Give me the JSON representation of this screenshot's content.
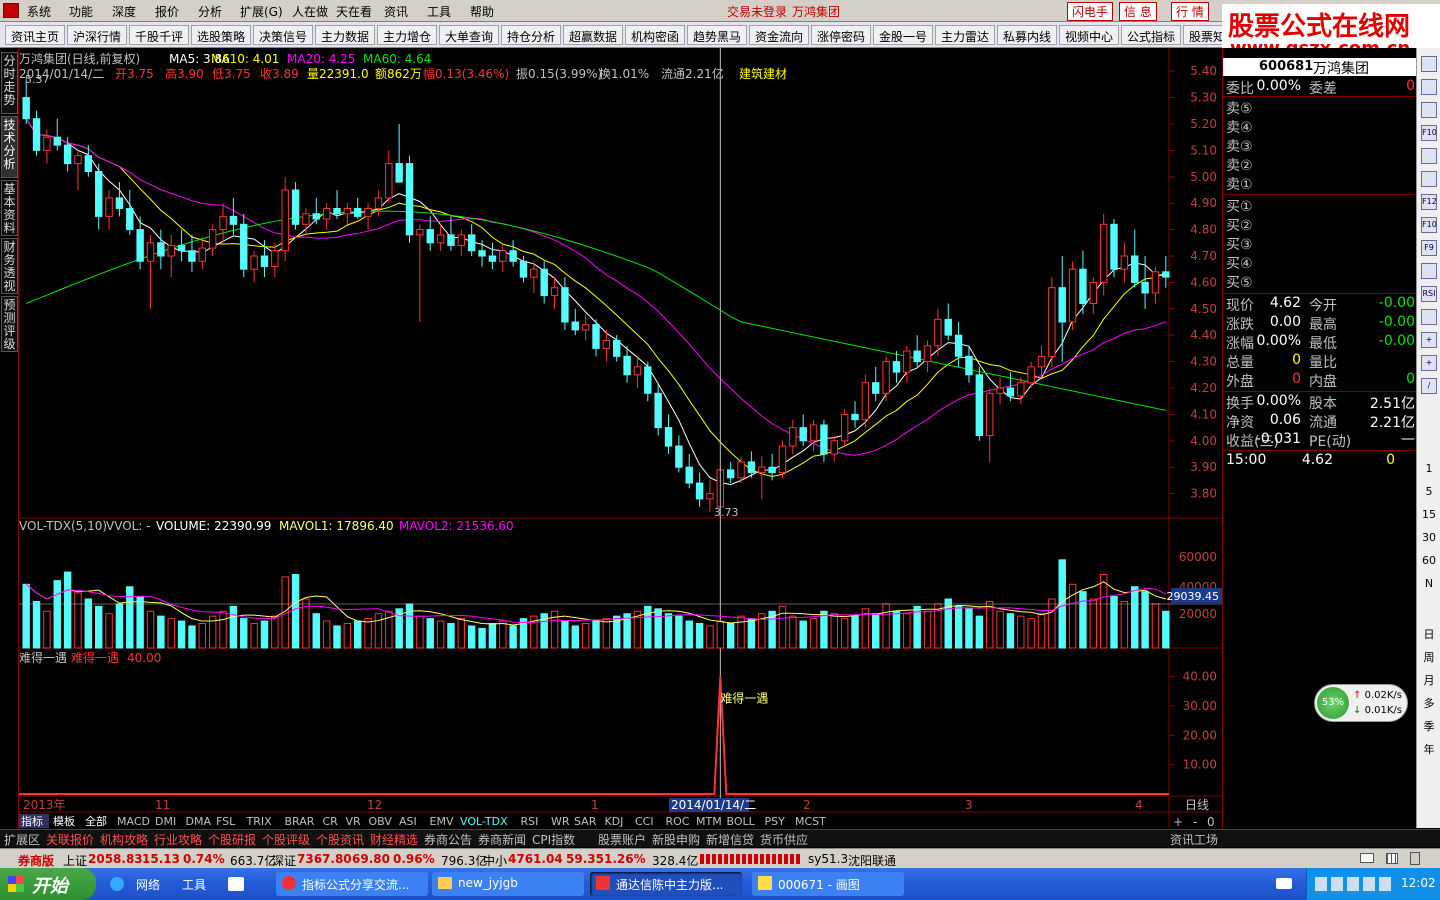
{
  "menubar": {
    "items": [
      "系统",
      "功能",
      "深度",
      "报价",
      "分析",
      "扩展(G)",
      "人在做",
      "天在看",
      "资讯",
      "工具",
      "帮助"
    ],
    "login_status": "交易未登录",
    "stock_name": "万鸿集团",
    "btn_flash": "闪电手",
    "btn_msg": "信 息",
    "btn_quote": "行 情"
  },
  "toolbar": {
    "items": [
      "资讯主页",
      "沪深行情",
      "千股千评",
      "选股策略",
      "决策信号",
      "主力数据",
      "主力增仓",
      "大单查询",
      "持仓分析",
      "超赢数据",
      "机构密函",
      "趋势黑马",
      "资金流向",
      "涨停密码",
      "金股一号",
      "主力雷达",
      "私募内线",
      "视频中心",
      "公式指标",
      "股票知识"
    ]
  },
  "watermark": {
    "line1": "股票公式在线网",
    "line2": "www.gszx.com.cn"
  },
  "vtabs": [
    "分时走势",
    "技术分析",
    "基本资料",
    "财务透视",
    "预测评级"
  ],
  "chart_header": {
    "title": "万鸿集团(日线,前复权)",
    "ma5": "MA5: 3.86",
    "ma10": "MA10: 4.01",
    "ma20": "MA20: 4.25",
    "ma60": "MA60: 4.64",
    "info": "2014/01/14/二",
    "open": "开3.75",
    "high": "高3.90",
    "low": "低3.75",
    "close": "收3.89",
    "vol": "量22391.0",
    "amount": "额862万",
    "change": "幅0.13(3.46%)",
    "amp": "振0.15(3.99%)",
    "turnover": "换1.01%",
    "float": "流通2.21亿",
    "sector": "建筑建材",
    "max_label": "5.37",
    "min_label": "3.73"
  },
  "vol_header": {
    "name": "VOL-TDX(5,10)",
    "vwol": "VVOL: -",
    "volume": "VOLUME: 22390.99",
    "mavol1": "MAVOL1: 17896.40",
    "mavol2": "MAVOL2: 21536.60",
    "axis": [
      "60000",
      "40000",
      "20000"
    ],
    "cursor_val": "29039.45"
  },
  "ind_header": {
    "name": "难得一遇",
    "label": "难得一遇",
    "value": "40.00",
    "signal_text": "难得一遇",
    "axis": [
      "40.00",
      "30.00",
      "20.00",
      "10.00"
    ]
  },
  "price_axis": [
    "5.40",
    "5.30",
    "5.20",
    "5.10",
    "5.00",
    "4.90",
    "4.80",
    "4.70",
    "4.60",
    "4.50",
    "4.40",
    "4.30",
    "4.20",
    "4.10",
    "4.00",
    "3.90",
    "3.80"
  ],
  "date_axis": {
    "labels": [
      "2013年",
      "11",
      "12",
      "1",
      "2014/01/14/二",
      "2",
      "3",
      "4"
    ],
    "period": "日线"
  },
  "indicator_tabs": [
    "指标",
    "模板",
    "全部",
    "MACD",
    "DMI",
    "DMA",
    "FSL",
    "TRIX",
    "BRAR",
    "CR",
    "VR",
    "OBV",
    "ASI",
    "EMV",
    "VOL-TDX",
    "RSI",
    "WR",
    "SAR",
    "KDJ",
    "CCI",
    "ROC",
    "MTM",
    "BOLL",
    "PSY",
    "MCST"
  ],
  "right_panel": {
    "code": "600681",
    "name": "万鸿集团",
    "weibi": {
      "label": "委比",
      "val": "0.00%",
      "label2": "委差",
      "val2": "0"
    },
    "sell": [
      "卖⑤",
      "卖④",
      "卖③",
      "卖②",
      "卖①"
    ],
    "buy": [
      "买①",
      "买②",
      "买③",
      "买④",
      "买⑤"
    ],
    "rows": [
      {
        "l1": "现价",
        "v1": "4.62",
        "l2": "今开",
        "v2": "-0.00"
      },
      {
        "l1": "涨跌",
        "v1": "0.00",
        "l2": "最高",
        "v2": "-0.00"
      },
      {
        "l1": "涨幅",
        "v1": "0.00%",
        "l2": "最低",
        "v2": "-0.00"
      },
      {
        "l1": "总量",
        "v1": "0",
        "l2": "量比",
        "v2": ""
      },
      {
        "l1": "外盘",
        "v1": "0",
        "l2": "内盘",
        "v2": "0"
      },
      {
        "l1": "换手",
        "v1": "0.00%",
        "l2": "股本",
        "v2": "2.51亿"
      },
      {
        "l1": "净资",
        "v1": "0.06",
        "l2": "流通",
        "v2": "2.21亿"
      },
      {
        "l1": "收益(三)",
        "v1": "-0.031",
        "l2": "PE(动)",
        "v2": "—"
      }
    ],
    "tick": {
      "time": "15:00",
      "price": "4.62",
      "vol": "0"
    },
    "bottom_tabs": [
      "笔",
      "价",
      "细",
      "盘",
      "势",
      "指",
      "值",
      "筹"
    ]
  },
  "right_icons": {
    "nums": [
      "1",
      "5",
      "15",
      "30",
      "60",
      "N"
    ],
    "periods": [
      "日",
      "周",
      "月",
      "多",
      "季",
      "年"
    ]
  },
  "speed": {
    "pct": "53%",
    "up": "0.02K/s",
    "down": "0.01K/s"
  },
  "bottom_tabs": [
    "扩展区",
    "关联报价",
    "机构攻略",
    "行业攻略",
    "个股研报",
    "个股评级",
    "个股资讯",
    "财经精选",
    "券商公告",
    "券商新闻",
    "CPI指数",
    "股票账户",
    "新股申购",
    "新增信贷",
    "货币供应",
    "资讯工场"
  ],
  "statusbar": {
    "brand": "券商版",
    "sh": "上证",
    "sh_val": "2058.83",
    "sh_chg": "15.13",
    "sh_pct": "0.74%",
    "sh_amt": "663.7亿",
    "sz": "深证",
    "sz_val": "7367.80",
    "sz_chg": "69.80",
    "sz_pct": "0.96%",
    "sz_amt": "796.3亿",
    "zx": "中小",
    "zx_val": "4761.04",
    "zx_chg": "59.35",
    "zx_pct": "1.26%",
    "zx_amt": "328.4亿",
    "server": "sy51.3",
    "isp": "沈阳联通"
  },
  "taskbar": {
    "start": "开始",
    "net": "网络",
    "tools": "工具",
    "tasks": [
      "指标公式分享交流...",
      "new_jyjgb",
      "通达信陈中主力版...",
      "000671 - 画图"
    ],
    "time": "12:02"
  },
  "colors": {
    "up": "#ff3232",
    "down": "#54fcfc",
    "ma5": "#ffffff",
    "ma10": "#ffff00",
    "ma20": "#ff00ff",
    "ma60": "#00e600",
    "grid": "#800000"
  },
  "chart_data": {
    "type": "candlestick",
    "ohlc": [
      [
        5.3,
        5.37,
        5.2,
        5.22
      ],
      [
        5.22,
        5.25,
        5.08,
        5.1
      ],
      [
        5.1,
        5.18,
        5.05,
        5.15
      ],
      [
        5.15,
        5.22,
        5.1,
        5.12
      ],
      [
        5.12,
        5.15,
        5.02,
        5.05
      ],
      [
        5.05,
        5.1,
        4.95,
        5.08
      ],
      [
        5.08,
        5.12,
        5.0,
        5.02
      ],
      [
        5.02,
        5.05,
        4.8,
        4.85
      ],
      [
        4.85,
        4.95,
        4.8,
        4.92
      ],
      [
        4.92,
        4.98,
        4.85,
        4.88
      ],
      [
        4.88,
        4.95,
        4.78,
        4.8
      ],
      [
        4.8,
        4.85,
        4.65,
        4.68
      ],
      [
        4.68,
        4.78,
        4.5,
        4.75
      ],
      [
        4.75,
        4.8,
        4.65,
        4.7
      ],
      [
        4.7,
        4.78,
        4.62,
        4.74
      ],
      [
        4.74,
        4.8,
        4.68,
        4.72
      ],
      [
        4.72,
        4.78,
        4.64,
        4.68
      ],
      [
        4.68,
        4.76,
        4.65,
        4.73
      ],
      [
        4.73,
        4.82,
        4.7,
        4.8
      ],
      [
        4.8,
        4.9,
        4.75,
        4.85
      ],
      [
        4.85,
        4.92,
        4.78,
        4.82
      ],
      [
        4.82,
        4.86,
        4.62,
        4.65
      ],
      [
        4.65,
        4.72,
        4.6,
        4.7
      ],
      [
        4.7,
        4.76,
        4.62,
        4.66
      ],
      [
        4.66,
        4.75,
        4.62,
        4.72
      ],
      [
        4.72,
        5.0,
        4.68,
        4.95
      ],
      [
        4.95,
        4.98,
        4.8,
        4.82
      ],
      [
        4.82,
        4.88,
        4.78,
        4.86
      ],
      [
        4.86,
        4.92,
        4.82,
        4.84
      ],
      [
        4.84,
        4.9,
        4.8,
        4.88
      ],
      [
        4.88,
        4.95,
        4.84,
        4.86
      ],
      [
        4.86,
        4.9,
        4.82,
        4.88
      ],
      [
        4.88,
        4.92,
        4.84,
        4.85
      ],
      [
        4.85,
        4.9,
        4.8,
        4.88
      ],
      [
        4.88,
        4.95,
        4.85,
        4.92
      ],
      [
        4.92,
        5.1,
        4.9,
        5.05
      ],
      [
        5.05,
        5.2,
        5.0,
        4.98
      ],
      [
        5.05,
        5.08,
        4.75,
        4.78
      ],
      [
        4.78,
        4.82,
        4.45,
        4.8
      ],
      [
        4.8,
        4.85,
        4.72,
        4.75
      ],
      [
        4.75,
        4.82,
        4.72,
        4.78
      ],
      [
        4.78,
        4.85,
        4.72,
        4.74
      ],
      [
        4.74,
        4.8,
        4.7,
        4.78
      ],
      [
        4.78,
        4.82,
        4.7,
        4.72
      ],
      [
        4.72,
        4.76,
        4.66,
        4.7
      ],
      [
        4.7,
        4.75,
        4.65,
        4.68
      ],
      [
        4.68,
        4.74,
        4.64,
        4.72
      ],
      [
        4.72,
        4.76,
        4.66,
        4.68
      ],
      [
        4.68,
        4.7,
        4.6,
        4.62
      ],
      [
        4.62,
        4.68,
        4.56,
        4.65
      ],
      [
        4.65,
        4.68,
        4.52,
        4.55
      ],
      [
        4.55,
        4.62,
        4.5,
        4.58
      ],
      [
        4.58,
        4.62,
        4.42,
        4.45
      ],
      [
        4.45,
        4.5,
        4.4,
        4.42
      ],
      [
        4.42,
        4.48,
        4.38,
        4.44
      ],
      [
        4.44,
        4.46,
        4.32,
        4.35
      ],
      [
        4.35,
        4.42,
        4.3,
        4.38
      ],
      [
        4.38,
        4.4,
        4.3,
        4.32
      ],
      [
        4.32,
        4.36,
        4.22,
        4.25
      ],
      [
        4.25,
        4.32,
        4.2,
        4.28
      ],
      [
        4.28,
        4.3,
        4.15,
        4.18
      ],
      [
        4.18,
        4.22,
        4.02,
        4.05
      ],
      [
        4.05,
        4.1,
        3.95,
        3.98
      ],
      [
        3.98,
        4.02,
        3.88,
        3.9
      ],
      [
        3.9,
        3.95,
        3.82,
        3.84
      ],
      [
        3.84,
        3.88,
        3.75,
        3.78
      ],
      [
        3.78,
        3.85,
        3.73,
        3.8
      ],
      [
        3.75,
        3.9,
        3.75,
        3.89
      ],
      [
        3.89,
        3.92,
        3.84,
        3.86
      ],
      [
        3.86,
        3.94,
        3.84,
        3.92
      ],
      [
        3.92,
        3.96,
        3.86,
        3.88
      ],
      [
        3.88,
        3.94,
        3.78,
        3.9
      ],
      [
        3.9,
        3.95,
        3.85,
        3.88
      ],
      [
        3.88,
        4.0,
        3.86,
        3.98
      ],
      [
        3.98,
        4.08,
        3.95,
        4.05
      ],
      [
        4.05,
        4.1,
        3.98,
        4.0
      ],
      [
        4.0,
        4.08,
        3.96,
        4.06
      ],
      [
        4.06,
        4.08,
        3.92,
        3.95
      ],
      [
        3.95,
        4.02,
        3.92,
        4.0
      ],
      [
        4.0,
        4.12,
        3.98,
        4.1
      ],
      [
        4.1,
        4.15,
        4.05,
        4.08
      ],
      [
        4.08,
        4.25,
        4.05,
        4.22
      ],
      [
        4.22,
        4.28,
        4.15,
        4.18
      ],
      [
        4.18,
        4.32,
        4.15,
        4.3
      ],
      [
        4.3,
        4.34,
        4.22,
        4.26
      ],
      [
        4.26,
        4.36,
        4.22,
        4.34
      ],
      [
        4.34,
        4.4,
        4.28,
        4.3
      ],
      [
        4.3,
        4.38,
        4.26,
        4.36
      ],
      [
        4.36,
        4.5,
        4.32,
        4.46
      ],
      [
        4.46,
        4.52,
        4.38,
        4.4
      ],
      [
        4.4,
        4.45,
        4.28,
        4.32
      ],
      [
        4.32,
        4.36,
        4.22,
        4.25
      ],
      [
        4.25,
        4.28,
        4.0,
        4.02
      ],
      [
        4.02,
        4.2,
        3.92,
        4.18
      ],
      [
        4.18,
        4.24,
        4.14,
        4.2
      ],
      [
        4.2,
        4.26,
        4.15,
        4.17
      ],
      [
        4.17,
        4.24,
        4.14,
        4.22
      ],
      [
        4.22,
        4.3,
        4.2,
        4.28
      ],
      [
        4.28,
        4.36,
        4.24,
        4.32
      ],
      [
        4.32,
        4.62,
        4.28,
        4.58
      ],
      [
        4.58,
        4.7,
        4.3,
        4.45
      ],
      [
        4.45,
        4.68,
        4.42,
        4.65
      ],
      [
        4.65,
        4.72,
        4.48,
        4.52
      ],
      [
        4.52,
        4.62,
        4.48,
        4.6
      ],
      [
        4.6,
        4.86,
        4.55,
        4.82
      ],
      [
        4.82,
        4.84,
        4.62,
        4.65
      ],
      [
        4.65,
        4.75,
        4.6,
        4.7
      ],
      [
        4.7,
        4.8,
        4.58,
        4.6
      ],
      [
        4.6,
        4.7,
        4.5,
        4.56
      ],
      [
        4.56,
        4.66,
        4.52,
        4.64
      ],
      [
        4.64,
        4.7,
        4.58,
        4.62
      ]
    ],
    "volume": [
      52,
      38,
      30,
      55,
      62,
      45,
      40,
      34,
      28,
      36,
      50,
      42,
      30,
      26,
      24,
      22,
      18,
      20,
      26,
      30,
      34,
      24,
      20,
      22,
      26,
      58,
      60,
      40,
      28,
      22,
      18,
      20,
      22,
      24,
      28,
      30,
      32,
      36,
      26,
      24,
      22,
      20,
      24,
      18,
      16,
      20,
      22,
      18,
      24,
      26,
      28,
      30,
      22,
      18,
      20,
      22,
      24,
      26,
      28,
      30,
      34,
      32,
      28,
      26,
      22,
      20,
      18,
      22,
      20,
      26,
      24,
      28,
      30,
      34,
      26,
      22,
      24,
      30,
      28,
      24,
      26,
      32,
      28,
      36,
      30,
      28,
      34,
      30,
      36,
      40,
      34,
      32,
      26,
      38,
      30,
      28,
      26,
      24,
      28,
      40,
      72,
      52,
      46,
      40,
      60,
      42,
      38,
      50,
      46,
      36,
      30
    ],
    "signal": {
      "index": 67,
      "value": 40
    },
    "price_range": [
      3.73,
      5.4
    ],
    "vol_max": 80000
  }
}
